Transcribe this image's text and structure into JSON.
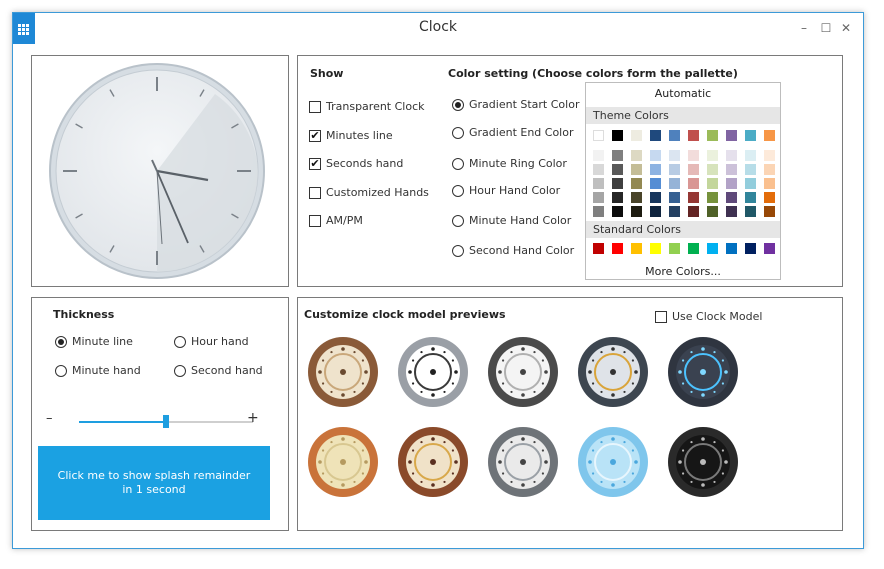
{
  "window": {
    "title": "Clock",
    "minimize_glyph": "–",
    "maximize_glyph": "☐",
    "close_glyph": "✕"
  },
  "show": {
    "heading": "Show",
    "items": [
      {
        "label": "Transparent Clock",
        "checked": false
      },
      {
        "label": "Minutes line",
        "checked": true
      },
      {
        "label": "Seconds hand",
        "checked": true
      },
      {
        "label": "Customized Hands",
        "checked": false
      },
      {
        "label": "AM/PM",
        "checked": false
      }
    ]
  },
  "color_setting": {
    "heading": "Color setting (Choose colors form the pallette)",
    "options": [
      {
        "label": "Gradient Start Color",
        "selected": true
      },
      {
        "label": "Gradient End Color",
        "selected": false
      },
      {
        "label": "Minute Ring Color",
        "selected": false
      },
      {
        "label": "Hour Hand Color",
        "selected": false
      },
      {
        "label": "Minute Hand Color",
        "selected": false
      },
      {
        "label": "Second Hand Color",
        "selected": false
      }
    ]
  },
  "palette": {
    "automatic": "Automatic",
    "theme_label": "Theme Colors",
    "standard_label": "Standard Colors",
    "more": "More Colors...",
    "theme_top": [
      "#ffffff",
      "#000000",
      "#eeece1",
      "#1f497d",
      "#4f81bd",
      "#c0504d",
      "#9bbb59",
      "#8064a2",
      "#4bacc6",
      "#f79646"
    ],
    "theme_shades": [
      [
        "#f2f2f2",
        "#7f7f7f",
        "#ddd9c3",
        "#c6d9f0",
        "#dbe5f1",
        "#f2dcdb",
        "#ebf1dd",
        "#e5e0ec",
        "#dbeef3",
        "#fdeada"
      ],
      [
        "#d8d8d8",
        "#595959",
        "#c4bd97",
        "#8db3e2",
        "#b8cce4",
        "#e5b9b7",
        "#d7e3bc",
        "#ccc1d9",
        "#b7dde8",
        "#fbd5b5"
      ],
      [
        "#bfbfbf",
        "#3f3f3f",
        "#938953",
        "#548dd4",
        "#95b3d7",
        "#d99694",
        "#c3d69b",
        "#b2a2c7",
        "#92cddc",
        "#fac08f"
      ],
      [
        "#a5a5a5",
        "#262626",
        "#494429",
        "#17365d",
        "#366092",
        "#953734",
        "#76923c",
        "#5f497a",
        "#31859b",
        "#e36c09"
      ],
      [
        "#7f7f7f",
        "#0c0c0c",
        "#1d1b10",
        "#0f243e",
        "#244061",
        "#632423",
        "#4f6128",
        "#3f3151",
        "#205867",
        "#974806"
      ]
    ],
    "standard": [
      "#c00000",
      "#ff0000",
      "#ffc000",
      "#ffff00",
      "#92d050",
      "#00b050",
      "#00b0f0",
      "#0070c0",
      "#002060",
      "#7030a0"
    ]
  },
  "thickness": {
    "heading": "Thickness",
    "options": [
      {
        "label": "Minute line",
        "selected": true
      },
      {
        "label": "Hour hand",
        "selected": false
      },
      {
        "label": "Minute hand",
        "selected": false
      },
      {
        "label": "Second hand",
        "selected": false
      }
    ],
    "minus": "–",
    "plus": "+",
    "slider_value": 0.5
  },
  "splash_button": "Click me to show  splash remainder in 1 second",
  "models": {
    "heading": "Customize clock model previews",
    "use_label": "Use Clock Model",
    "use_checked": false,
    "items": [
      {
        "name": "model-bronze-roman",
        "ring": "#8a5a38",
        "face": "#efe3cc",
        "accent": "#c9a77a",
        "dots": "#6a4a30"
      },
      {
        "name": "model-silver-black",
        "ring": "#9a9fa6",
        "face": "#ffffff",
        "accent": "#3a3a3a",
        "dots": "#222222"
      },
      {
        "name": "model-dark-rim-white",
        "ring": "#4a4a4a",
        "face": "#f4f4f4",
        "accent": "#b0b0b0",
        "dots": "#444444"
      },
      {
        "name": "model-steel-gold",
        "ring": "#3d4650",
        "face": "#dfe3e8",
        "accent": "#d9a43a",
        "dots": "#333333"
      },
      {
        "name": "model-dark-blue-dots",
        "ring": "#2f3540",
        "face": "#3a4250",
        "accent": "#4cc3ff",
        "dots": "#7fd8ff"
      },
      {
        "name": "model-orange-rabbit",
        "ring": "#c9733a",
        "face": "#efe3b8",
        "accent": "#d8c790",
        "dots": "#b59a60"
      },
      {
        "name": "model-copper-gold",
        "ring": "#8a4a2a",
        "face": "#f0e2c8",
        "accent": "#d8a84a",
        "dots": "#5a3020"
      },
      {
        "name": "model-grey-white",
        "ring": "#6e7378",
        "face": "#eaeaea",
        "accent": "#9aa0a6",
        "dots": "#444444"
      },
      {
        "name": "model-light-blue",
        "ring": "#7fc6ec",
        "face": "#b9e3f7",
        "accent": "#e8f6fd",
        "dots": "#4aa7dd"
      },
      {
        "name": "model-black-chrome",
        "ring": "#2a2a2a",
        "face": "#161616",
        "accent": "#7a7a7a",
        "dots": "#bbbbbb"
      }
    ]
  }
}
